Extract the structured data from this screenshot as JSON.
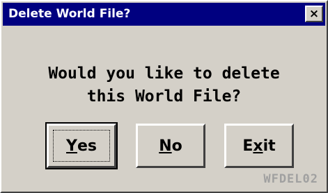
{
  "window": {
    "title": "Delete World File?",
    "close_glyph": "×",
    "close_icon": "close-icon"
  },
  "message": {
    "line1": "Would you like to delete",
    "line2": "this World File?"
  },
  "buttons": {
    "yes": {
      "mnemonic": "Y",
      "rest": "es"
    },
    "no": {
      "mnemonic": "N",
      "rest": "o"
    },
    "exit": {
      "before": "E",
      "mnemonic": "x",
      "after": "it"
    }
  },
  "dialog_code": "WFDEL02",
  "colors": {
    "titlebar": "#000080",
    "face": "#d4d0c8",
    "code_text": "#a0a0a0"
  }
}
